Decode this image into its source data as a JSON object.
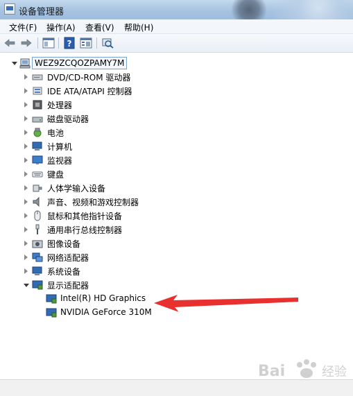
{
  "window": {
    "title": "设备管理器"
  },
  "menu": {
    "items": [
      "文件(F)",
      "操作(A)",
      "查看(V)",
      "帮助(H)"
    ]
  },
  "toolbar": {
    "buttons": [
      "back-arrow-icon",
      "forward-arrow-icon",
      "properties-icon",
      "help-icon",
      "console-tree-icon",
      "scan-hardware-icon"
    ]
  },
  "tree": {
    "root": "WEZ9ZCQOZPAMY7M",
    "categories": [
      {
        "label": "DVD/CD-ROM 驱动器",
        "icon": "dvd-drive-icon",
        "expanded": false
      },
      {
        "label": "IDE ATA/ATAPI 控制器",
        "icon": "ide-controller-icon",
        "expanded": false
      },
      {
        "label": "处理器",
        "icon": "processor-icon",
        "expanded": false
      },
      {
        "label": "磁盘驱动器",
        "icon": "disk-drive-icon",
        "expanded": false
      },
      {
        "label": "电池",
        "icon": "battery-icon",
        "expanded": false
      },
      {
        "label": "计算机",
        "icon": "computer-icon",
        "expanded": false
      },
      {
        "label": "监视器",
        "icon": "monitor-icon",
        "expanded": false
      },
      {
        "label": "键盘",
        "icon": "keyboard-icon",
        "expanded": false
      },
      {
        "label": "人体学输入设备",
        "icon": "hid-icon",
        "expanded": false
      },
      {
        "label": "声音、视频和游戏控制器",
        "icon": "sound-icon",
        "expanded": false
      },
      {
        "label": "鼠标和其他指针设备",
        "icon": "mouse-icon",
        "expanded": false
      },
      {
        "label": "通用串行总线控制器",
        "icon": "usb-icon",
        "expanded": false
      },
      {
        "label": "图像设备",
        "icon": "camera-icon",
        "expanded": false
      },
      {
        "label": "网络适配器",
        "icon": "network-adapter-icon",
        "expanded": false
      },
      {
        "label": "系统设备",
        "icon": "system-device-icon",
        "expanded": false
      },
      {
        "label": "显示适配器",
        "icon": "display-adapter-icon",
        "expanded": true
      }
    ],
    "display_adapters": [
      "Intel(R) HD Graphics",
      "NVIDIA GeForce 310M"
    ]
  },
  "annotation": {
    "color": "#e8302e"
  },
  "watermark": {
    "text": "Bai 经验"
  }
}
